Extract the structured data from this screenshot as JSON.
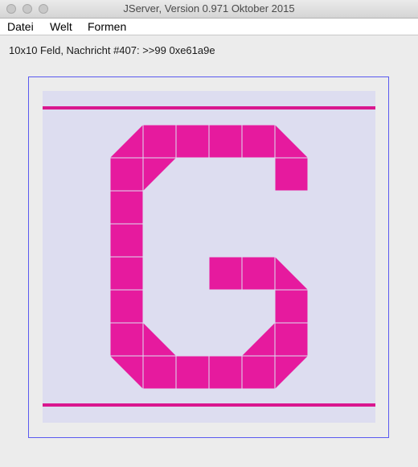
{
  "window": {
    "title": "JServer, Version 0.971 Oktober 2015"
  },
  "menu": {
    "items": [
      {
        "label": "Datei"
      },
      {
        "label": "Welt"
      },
      {
        "label": "Formen"
      }
    ]
  },
  "status": {
    "message": "10x10 Feld, Nachricht #407: >>99 0xe61a9e"
  },
  "board": {
    "columns": 10,
    "rows": 10,
    "colors": {
      "background": "#ddddf0",
      "symbol": "#e61a9e",
      "rule_lines": "#d9178f",
      "frame": "#5a5af0"
    },
    "shape_legend": {
      "F": "full square",
      "TR": "triangle bottom-right",
      "TL": "triangle bottom-left",
      "BR": "triangle top-right",
      "BL": "triangle top-left"
    },
    "cells": [
      {
        "row": 1,
        "col": 2,
        "shape": "TR"
      },
      {
        "row": 1,
        "col": 3,
        "shape": "F"
      },
      {
        "row": 1,
        "col": 4,
        "shape": "F"
      },
      {
        "row": 1,
        "col": 5,
        "shape": "F"
      },
      {
        "row": 1,
        "col": 6,
        "shape": "F"
      },
      {
        "row": 1,
        "col": 7,
        "shape": "TL"
      },
      {
        "row": 2,
        "col": 2,
        "shape": "F"
      },
      {
        "row": 2,
        "col": 3,
        "shape": "BL"
      },
      {
        "row": 2,
        "col": 7,
        "shape": "F"
      },
      {
        "row": 3,
        "col": 2,
        "shape": "F"
      },
      {
        "row": 4,
        "col": 2,
        "shape": "F"
      },
      {
        "row": 5,
        "col": 2,
        "shape": "F"
      },
      {
        "row": 5,
        "col": 5,
        "shape": "F"
      },
      {
        "row": 5,
        "col": 6,
        "shape": "F"
      },
      {
        "row": 5,
        "col": 7,
        "shape": "TL"
      },
      {
        "row": 6,
        "col": 2,
        "shape": "F"
      },
      {
        "row": 6,
        "col": 7,
        "shape": "F"
      },
      {
        "row": 7,
        "col": 2,
        "shape": "F"
      },
      {
        "row": 7,
        "col": 3,
        "shape": "TL"
      },
      {
        "row": 7,
        "col": 6,
        "shape": "TR"
      },
      {
        "row": 7,
        "col": 7,
        "shape": "F"
      },
      {
        "row": 8,
        "col": 2,
        "shape": "BR"
      },
      {
        "row": 8,
        "col": 3,
        "shape": "F"
      },
      {
        "row": 8,
        "col": 4,
        "shape": "F"
      },
      {
        "row": 8,
        "col": 5,
        "shape": "F"
      },
      {
        "row": 8,
        "col": 6,
        "shape": "F"
      },
      {
        "row": 8,
        "col": 7,
        "shape": "BL"
      }
    ]
  }
}
